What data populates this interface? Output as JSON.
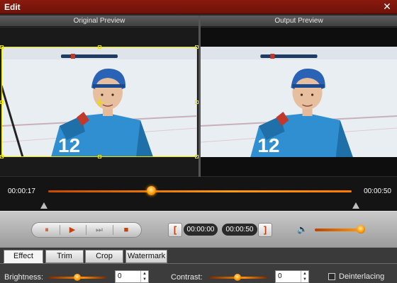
{
  "window": {
    "title": "Edit",
    "close_glyph": "✕"
  },
  "preview": {
    "original_label": "Original Preview",
    "output_label": "Output Preview"
  },
  "timeline": {
    "current_time": "00:00:17",
    "end_time": "00:00:50",
    "playhead_fraction": 0.34
  },
  "transport": {
    "pause_glyph": "⏸",
    "play_glyph": "▶",
    "next_frame_glyph": "⏭",
    "stop_glyph": "■"
  },
  "clip": {
    "set_start_glyph": "[",
    "start_time": "00:00:00",
    "end_time": "00:00:50",
    "set_end_glyph": "]"
  },
  "volume": {
    "icon": "speaker-icon",
    "icon_glyph": "🔈",
    "level_fraction": 0.92
  },
  "tabs": [
    {
      "label": "Effect",
      "active": true
    },
    {
      "label": "Trim",
      "active": false
    },
    {
      "label": "Crop",
      "active": false
    },
    {
      "label": "Watermark",
      "active": false
    }
  ],
  "effect": {
    "brightness_label": "Brightness:",
    "brightness_value": "0",
    "contrast_label": "Contrast:",
    "contrast_value": "0",
    "deinterlacing_label": "Deinterlacing",
    "deinterlacing_checked": false
  },
  "colors": {
    "accent": "#ff9a00",
    "titlebar": "#7a160b",
    "crop_outline": "#e8e300"
  }
}
